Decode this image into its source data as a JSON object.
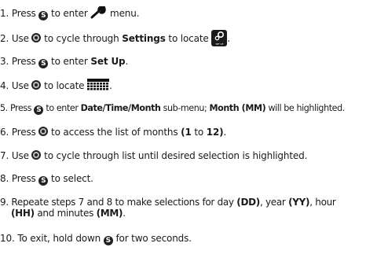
{
  "steps": [
    {
      "num": "1.",
      "t1": "Press",
      "t2": "to enter",
      "t3": "menu."
    },
    {
      "num": "2.",
      "t1": "Use",
      "t2": "to cycle through",
      "bold": "Settings",
      "t3": "to locate",
      "t4": ".",
      "setup_icon_label": "SET UP"
    },
    {
      "num": "3.",
      "t1": "Press",
      "t2": "to enter",
      "bold": "Set Up",
      "t3": "."
    },
    {
      "num": "4.",
      "t1": "Use",
      "t2": "to locate",
      "t3": "."
    },
    {
      "num": "5.",
      "t1": "Press",
      "t2": "to enter",
      "bold1": "Date/Time/Month",
      "t3": "sub-menu;",
      "bold2": "Month (MM)",
      "t4": "will be highlighted."
    },
    {
      "num": "6.",
      "t1": "Press",
      "t2": "to access the list of months",
      "bold": "(1",
      "t3": "to",
      "bold2": "12)",
      "t4": "."
    },
    {
      "num": "7.",
      "t1": "Use",
      "t2": "to cycle through list until desired selection is highlighted."
    },
    {
      "num": "8.",
      "t1": "Press",
      "t2": "to select."
    },
    {
      "num": "9.",
      "t1": "Repeate steps 7 and 8 to make selections for day",
      "bold1": "(DD)",
      "t2": ", year",
      "bold2": "(YY)",
      "t3": ", hour",
      "bold3": "(HH)",
      "t4": "and minutes",
      "bold4": "(MM)",
      "t5": "."
    },
    {
      "num": "10.",
      "t1": "To exit, hold down",
      "t2": "for two seconds."
    }
  ],
  "icons": {
    "select_button": "S",
    "dial": "scroll-dial-icon",
    "wrench": "wrench-icon",
    "setup": "setup-icon",
    "calendar": "calendar-icon"
  }
}
